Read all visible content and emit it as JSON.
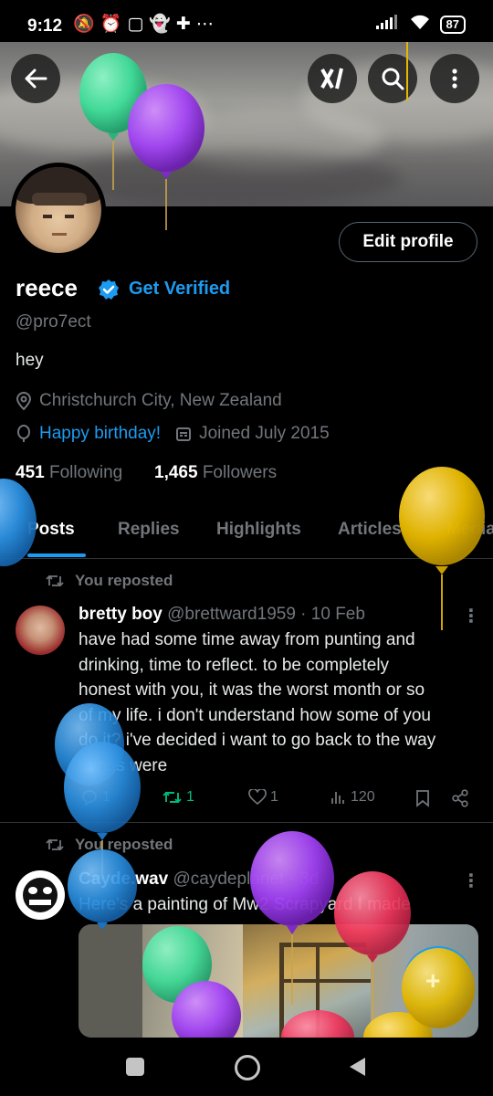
{
  "status_bar": {
    "time": "9:12",
    "battery": "87"
  },
  "profile": {
    "name": "reece",
    "get_verified": "Get Verified",
    "handle": "@pro7ect",
    "bio": "hey",
    "location": "Christchurch City, New Zealand",
    "birthday": "Happy birthday!",
    "joined": "Joined July 2015",
    "following_count": "451",
    "following_label": "Following",
    "followers_count": "1,465",
    "followers_label": "Followers",
    "edit_profile": "Edit profile"
  },
  "tabs": [
    {
      "label": "Posts",
      "active": true
    },
    {
      "label": "Replies"
    },
    {
      "label": "Highlights"
    },
    {
      "label": "Articles"
    },
    {
      "label": "Media"
    }
  ],
  "posts": [
    {
      "repost_label": "You reposted",
      "author": "bretty boy",
      "handle_date": "@brettward1959 · 10 Feb",
      "lines": [
        "have had some time away from punting and",
        "drinking, time to reflect. to be completely",
        "honest with you, it was the worst month or so",
        "of my life. i don't understand how some of you",
        "do it? i've decided i want to go back to the way",
        "things were"
      ],
      "replies": "1",
      "reposts": "1",
      "likes": "1",
      "views": "120"
    },
    {
      "repost_label": "You reposted",
      "author": "Cayde.wav",
      "handle_date": "@caydeplanet · 3d",
      "lines": [
        "Here's a painting of Mw2 Scrapyard I made"
      ]
    }
  ],
  "fab_label": "+",
  "colors": {
    "accent": "#1d9bf0",
    "repost_green": "#00ba7c",
    "muted": "#71767b",
    "balloons": [
      "#3ddc97",
      "#a142f4",
      "#2a8fe0",
      "#e6b800",
      "#f0385e"
    ]
  },
  "icons": [
    "back-arrow-icon",
    "grok-icon",
    "search-icon",
    "more-vertical-icon",
    "verified-badge-icon",
    "location-pin-icon",
    "balloon-icon",
    "calendar-icon",
    "repost-icon",
    "reply-icon",
    "heart-icon",
    "views-icon",
    "bookmark-icon",
    "share-icon",
    "home-square-icon",
    "home-circle-icon",
    "back-triangle-icon"
  ]
}
